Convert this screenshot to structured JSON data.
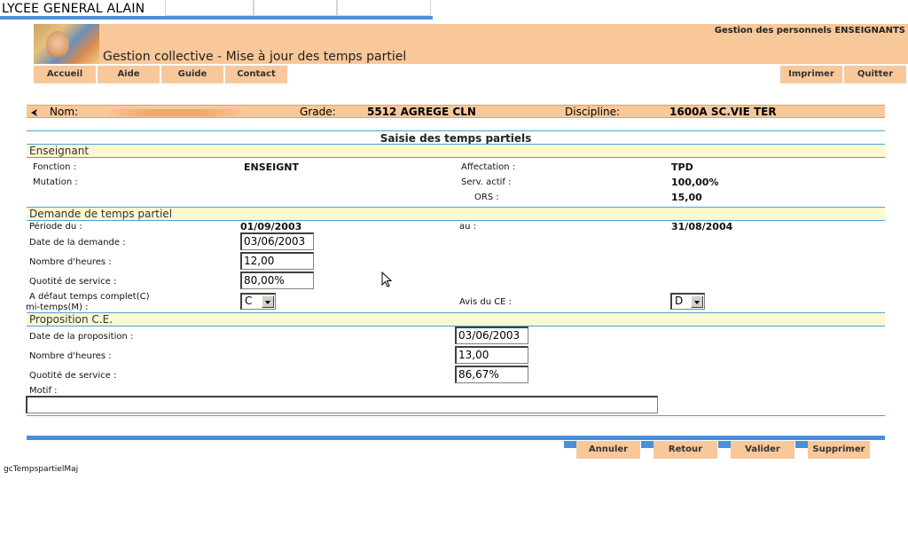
{
  "school": "LYCEE GENERAL ALAIN",
  "header": {
    "app_subtitle": "Gestion des personnels ENSEIGNANTS",
    "title": "Gestion collective - Mise à jour des temps partiel"
  },
  "menu": {
    "left": [
      "Accueil",
      "Aide",
      "Guide",
      "Contact"
    ],
    "right": [
      "Imprimer",
      "Quitter"
    ]
  },
  "infobar": {
    "nom_label": "Nom:",
    "grade_label": "Grade:",
    "grade_value": "5512 AGREGE CLN",
    "discipline_label": "Discipline:",
    "discipline_value": "1600A SC.VIE TER"
  },
  "form": {
    "title": "Saisie des temps partiels",
    "enseignant": {
      "section": "Enseignant",
      "fonction_label": "Fonction :",
      "fonction_value": "ENSEIGNT",
      "mutation_label": "Mutation :",
      "affectation_label": "Affectation :",
      "affectation_value": "TPD",
      "serv_actif_label": "Serv. actif :",
      "serv_actif_value": "100,00%",
      "ors_label": "ORS :",
      "ors_value": "15,00"
    },
    "demande": {
      "section": "Demande de temps partiel",
      "periode_label": "Période du :",
      "periode_du": "01/09/2003",
      "au_label": "au :",
      "periode_au": "31/08/2004",
      "date_demande_label": "Date de la demande :",
      "date_demande_value": "03/06/2003",
      "nb_heures_label": "Nombre d'heures :",
      "nb_heures_value": "12,00",
      "quotite_label": "Quotité de service :",
      "quotite_value": "80,00%",
      "defaut_label_1": "A défaut temps complet(C)",
      "defaut_label_2": "mi-temps(M) :",
      "defaut_value": "C",
      "avis_label": "Avis du CE :",
      "avis_value": "D"
    },
    "proposition": {
      "section": "Proposition C.E.",
      "date_label": "Date de la proposition :",
      "date_value": "03/06/2003",
      "nb_heures_label": "Nombre d'heures :",
      "nb_heures_value": "13,00",
      "quotite_label": "Quotité de service :",
      "quotite_value": "86,67%",
      "motif_label": "Motif :",
      "motif_value": ""
    }
  },
  "actions": [
    "Annuler",
    "Retour",
    "Valider",
    "Supprimer"
  ],
  "footer": "gcTempspartielMaj",
  "colors": {
    "accent": "#f8c89a",
    "blue": "#4a90d9",
    "section_bg": "#fcf8d2"
  }
}
